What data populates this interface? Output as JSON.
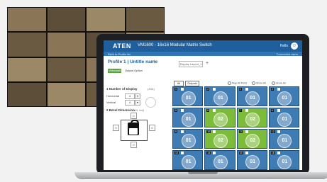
{
  "app": {
    "logo": "ATEN",
    "title": "VM1600 - 16x16 Modular Matrix Switch",
    "user_label": "Hello",
    "user_icon": "user-circle-icon"
  },
  "subbar": {
    "back_label": "Back to Profile list",
    "right_label": "Connected users"
  },
  "profile": {
    "title": "Profile 1 | Untitle name",
    "edit_icon": "pencil-icon",
    "display_layout": "Display Layout_1",
    "add_icon": "plus-icon"
  },
  "tabs": {
    "active": "Videowall",
    "output": "Output Option"
  },
  "left_panel": {
    "heading": "1 Number of Display",
    "heading_right": "(4X4)",
    "horizontal_label": "Horizontal",
    "horizontal_value": "4",
    "vertical_label": "Vertical",
    "vertical_value": "4",
    "heading2": "2 Bezel Dimension",
    "heading2_small": "(unit: mm)",
    "lock_icon": "lock-icon",
    "top_value": "0",
    "left_value": "0",
    "right_value": "0",
    "bottom_value": "0"
  },
  "grid_toolbar": {
    "btn1": "All",
    "btn2": "Outputs",
    "opt1": "Map All Ports",
    "opt2": "Show All",
    "opt3": "Show All"
  },
  "tiles": [
    {
      "num": "1",
      "label": "01",
      "color": "blue"
    },
    {
      "num": "2",
      "label": "01",
      "color": "blue"
    },
    {
      "num": "3",
      "label": "01",
      "color": "blue"
    },
    {
      "num": "4",
      "label": "01",
      "color": "blue"
    },
    {
      "num": "5",
      "label": "01",
      "color": "blue"
    },
    {
      "num": "6",
      "label": "02",
      "color": "green"
    },
    {
      "num": "7",
      "label": "02",
      "color": "green"
    },
    {
      "num": "8",
      "label": "01",
      "color": "blue"
    },
    {
      "num": "9",
      "label": "01",
      "color": "blue"
    },
    {
      "num": "10",
      "label": "02",
      "color": "green"
    },
    {
      "num": "11",
      "label": "02",
      "color": "green"
    },
    {
      "num": "12",
      "label": "01",
      "color": "blue"
    },
    {
      "num": "13",
      "label": "01",
      "color": "blue"
    },
    {
      "num": "14",
      "label": "01",
      "color": "blue"
    },
    {
      "num": "15",
      "label": "01",
      "color": "blue"
    },
    {
      "num": "16",
      "label": "01",
      "color": "blue"
    }
  ],
  "colors": {
    "titlebar": "#1e5f9c",
    "tile_blue": "#3f7cb3",
    "tile_green": "#7dbb3a",
    "tab_active": "#5aa342"
  }
}
